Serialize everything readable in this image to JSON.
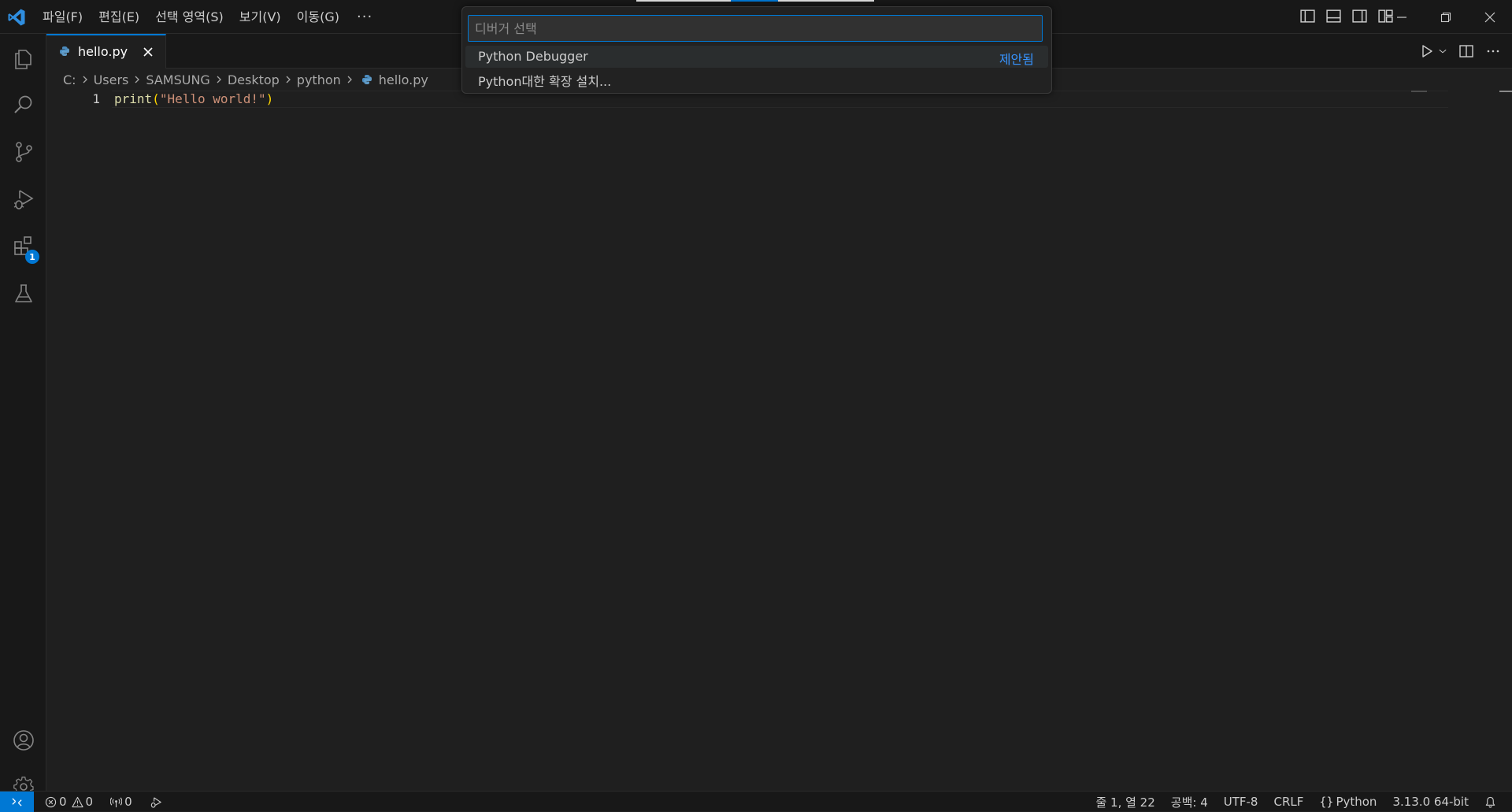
{
  "menu": {
    "items": [
      "파일(F)",
      "편집(E)",
      "선택 영역(S)",
      "보기(V)",
      "이동(G)"
    ],
    "more": "···"
  },
  "activity_bar": {
    "items": [
      "explorer-icon",
      "search-icon",
      "source-control-icon",
      "run-debug-icon",
      "extensions-icon",
      "testing-icon"
    ],
    "extensions_badge": "1",
    "bottom": [
      "accounts-icon",
      "manage-gear-icon"
    ]
  },
  "tab": {
    "label": "hello.py",
    "icon": "python-file-icon"
  },
  "breadcrumb": [
    "C:",
    "Users",
    "SAMSUNG",
    "Desktop",
    "python",
    "hello.py"
  ],
  "editor": {
    "line_number": "1",
    "code": {
      "fn": "print",
      "open": "(",
      "str": "\"Hello world!\"",
      "close": ")"
    }
  },
  "quick_pick": {
    "placeholder": "디버거 선택",
    "items": [
      {
        "label": "Python Debugger",
        "description": "제안됨"
      },
      {
        "label": "Python대한 확장 설치..."
      }
    ]
  },
  "status_bar": {
    "errors": "0",
    "warnings": "0",
    "ports": "0",
    "position": "줄 1, 열 22",
    "spaces": "공백: 4",
    "encoding": "UTF-8",
    "eol": "CRLF",
    "language": "Python",
    "interpreter": "3.13.0 64-bit"
  },
  "colors": {
    "accent": "#0078d4",
    "suggestion": "#3794ff",
    "background": "#1f1f1f",
    "chrome": "#181818"
  }
}
